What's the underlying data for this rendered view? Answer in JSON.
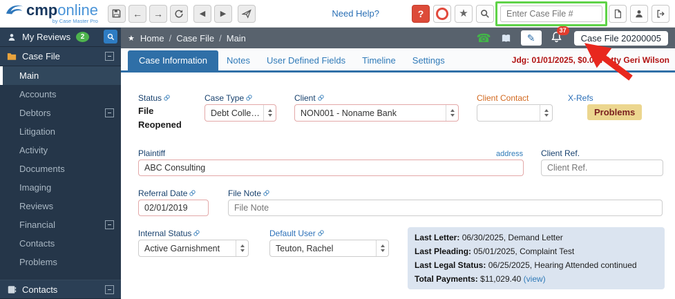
{
  "topbar": {
    "logo_cmp": "cmp",
    "logo_online": "online",
    "logo_tagline": "by Case Master Pro",
    "need_help": "Need Help?",
    "case_search_placeholder": "Enter Case File #"
  },
  "icons": {
    "arrow_left": "←",
    "arrow_right": "→",
    "record_prev": "◀",
    "record_next": "▶",
    "star": "★",
    "question": "?",
    "phone": "☎",
    "pencil": "✎",
    "crumb_star": "★",
    "separator": "/"
  },
  "sidebar": {
    "my_reviews_label": "My Reviews",
    "my_reviews_badge": "2",
    "case_file_label": "Case File",
    "items": [
      {
        "label": "Main"
      },
      {
        "label": "Accounts"
      },
      {
        "label": "Debtors"
      },
      {
        "label": "Litigation"
      },
      {
        "label": "Activity"
      },
      {
        "label": "Documents"
      },
      {
        "label": "Imaging"
      },
      {
        "label": "Reviews"
      },
      {
        "label": "Financial"
      },
      {
        "label": "Contacts"
      },
      {
        "label": "Problems"
      }
    ],
    "contacts_label": "Contacts"
  },
  "breadcrumb": {
    "home": "Home",
    "case_file": "Case File",
    "main": "Main",
    "bell_badge": "37",
    "case_number_label": "Case File 20200005"
  },
  "tabs": [
    {
      "label": "Case Information"
    },
    {
      "label": "Notes"
    },
    {
      "label": "User Defined Fields"
    },
    {
      "label": "Timeline"
    },
    {
      "label": "Settings"
    }
  ],
  "status_line": "Jdg: 01/01/2025, $0.00 / Atty Geri Wilson",
  "form": {
    "status": {
      "label": "Status",
      "value": "File Reopened"
    },
    "case_type": {
      "label": "Case Type",
      "value": "Debt Collection"
    },
    "client": {
      "label": "Client",
      "value": "NON001 - Noname Bank"
    },
    "client_contact": {
      "label": "Client Contact",
      "value": ""
    },
    "xrefs": {
      "label": "X-Refs",
      "badge": "Problems"
    },
    "plaintiff": {
      "label": "Plaintiff",
      "value": "ABC Consulting",
      "address_link": "address"
    },
    "client_ref": {
      "label": "Client Ref.",
      "placeholder": "Client Ref."
    },
    "referral_date": {
      "label": "Referral Date",
      "value": "02/01/2019"
    },
    "file_note": {
      "label": "File Note",
      "placeholder": "File Note"
    },
    "internal_status": {
      "label": "Internal Status",
      "value": "Active Garnishment"
    },
    "default_user": {
      "label": "Default User",
      "value": "Teuton, Rachel"
    },
    "summary": {
      "last_letter_label": "Last Letter:",
      "last_letter_value": "06/30/2025, Demand Letter",
      "last_pleading_label": "Last Pleading:",
      "last_pleading_value": "05/01/2025, Complaint Test",
      "last_legal_label": "Last Legal Status:",
      "last_legal_value": "06/25/2025, Hearing Attended continued",
      "total_payments_label": "Total Payments:",
      "total_payments_value": "$11,029.40",
      "view_link": "(view)"
    }
  }
}
